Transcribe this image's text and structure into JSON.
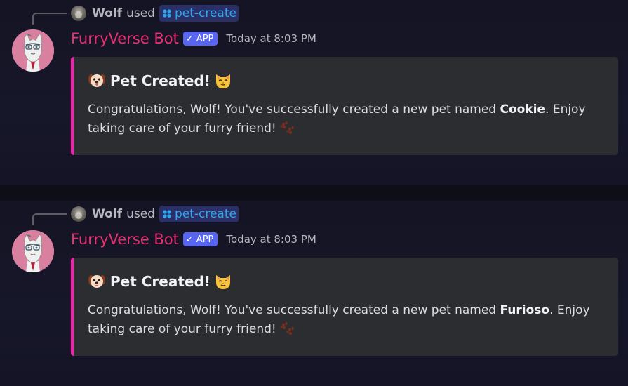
{
  "messages": [
    {
      "reply": {
        "user": "Wolf",
        "used": "used",
        "command": "pet-create"
      },
      "author": {
        "name": "FurryVerse Bot",
        "badge": "APP",
        "timestamp": "Today at 8:03 PM"
      },
      "embed": {
        "title": "Pet Created!",
        "desc_before": "Congratulations, Wolf! You've successfully created a new pet named ",
        "pet_name": "Cookie",
        "desc_after": ". Enjoy taking care of your furry friend!"
      }
    },
    {
      "reply": {
        "user": "Wolf",
        "used": "used",
        "command": "pet-create"
      },
      "author": {
        "name": "FurryVerse Bot",
        "badge": "APP",
        "timestamp": "Today at 8:03 PM"
      },
      "embed": {
        "title": "Pet Created!",
        "desc_before": "Congratulations, Wolf! You've successfully created a new pet named ",
        "pet_name": "Furioso",
        "desc_after": ". Enjoy taking care of your furry friend!"
      }
    }
  ],
  "colors": {
    "bot_name": "#e73172",
    "embed_accent": "#ff1ab3",
    "command_text": "#2ea6f2",
    "app_badge": "#5865f2"
  },
  "icons": {
    "title_left": "dog-face-icon",
    "title_right": "cat-face-icon",
    "desc_end": "paw-prints-icon",
    "command": "app-command-icon",
    "badge": "checkmark-icon"
  }
}
